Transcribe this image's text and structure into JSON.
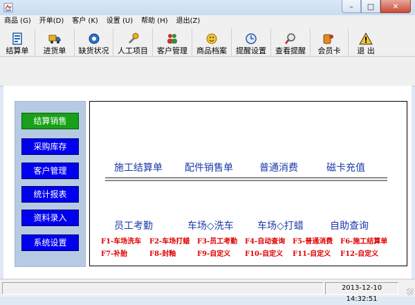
{
  "window": {
    "minimize_icon": "minimize-icon",
    "maximize_icon": "maximize-icon",
    "close_icon": "close-icon"
  },
  "menu": [
    {
      "label": "商品 (G)"
    },
    {
      "label": "开单(D)"
    },
    {
      "label": "客户 (K)"
    },
    {
      "label": "设置 (U)"
    },
    {
      "label": "帮助 (H)"
    },
    {
      "label": "退出(Z)"
    }
  ],
  "toolbar": [
    {
      "label": "结算单",
      "icon": "invoice-icon"
    },
    {
      "label": "进货单",
      "icon": "truck-icon"
    },
    {
      "label": "缺货状况",
      "icon": "gear-icon"
    },
    {
      "label": "人工项目",
      "icon": "wrench-icon"
    },
    {
      "label": "客户管理",
      "icon": "users-icon"
    },
    {
      "label": "商品档案",
      "icon": "product-icon"
    },
    {
      "label": "提醒设置",
      "icon": "clock-icon"
    },
    {
      "label": "查看提醒",
      "icon": "magnifier-icon"
    },
    {
      "label": "会员卡",
      "icon": "member-card-icon"
    },
    {
      "label": "退  出",
      "icon": "warning-icon"
    }
  ],
  "sidebar": [
    {
      "label": "结算销售",
      "active": true
    },
    {
      "label": "采购库存"
    },
    {
      "label": "客户管理"
    },
    {
      "label": "统计报表"
    },
    {
      "label": "资料录入"
    },
    {
      "label": "系统设置"
    }
  ],
  "panel": {
    "top_links": [
      "施工结算单",
      "配件销售单",
      "普通消费",
      "磁卡充值"
    ],
    "bottom_links": [
      "员工考勤",
      "车场◇洗车",
      "车场◇打蜡",
      "自助查询"
    ],
    "fkeys_row1": [
      "F1-车场洗车",
      "F2-车场打蜡",
      "F3-员工考勤",
      "F4-自动查询",
      "F5-普通消费",
      "F6-施工结算单"
    ],
    "fkeys_row2": [
      "F7-补胎",
      "F8-封釉",
      "F9-自定义",
      "F10-自定义",
      "F11-自定义",
      "F12-自定义"
    ]
  },
  "status": {
    "datetime": "2013-12-10 14:32:51"
  },
  "colors": {
    "active_nav": "#18a018",
    "nav": "#0000ee",
    "link": "#1a3aa8",
    "fkey": "#e00000"
  }
}
